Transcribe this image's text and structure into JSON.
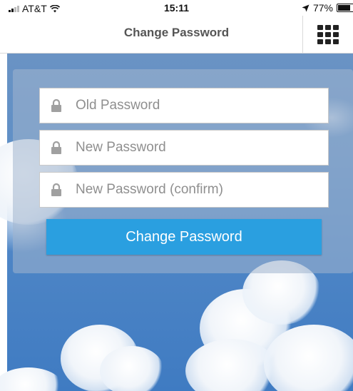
{
  "status_bar": {
    "carrier": "AT&T",
    "time": "15:11",
    "battery_percent": "77%"
  },
  "nav": {
    "title": "Change Password",
    "menu_icon": "grid-menu-icon"
  },
  "form": {
    "old_password": {
      "placeholder": "Old Password",
      "value": ""
    },
    "new_password": {
      "placeholder": "New Password",
      "value": ""
    },
    "confirm_password": {
      "placeholder": "New Password (confirm)",
      "value": ""
    },
    "submit_label": "Change Password"
  },
  "colors": {
    "primary_button": "#2a9fe0",
    "nav_title": "#555555"
  }
}
